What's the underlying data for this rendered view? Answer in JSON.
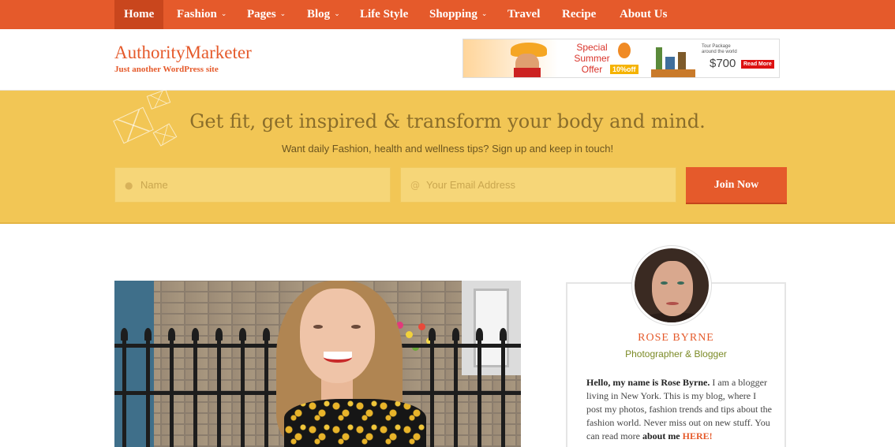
{
  "nav": {
    "items": [
      {
        "label": "Home",
        "active": true,
        "dropdown": false
      },
      {
        "label": "Fashion",
        "active": false,
        "dropdown": true
      },
      {
        "label": "Pages",
        "active": false,
        "dropdown": true
      },
      {
        "label": "Blog",
        "active": false,
        "dropdown": true
      },
      {
        "label": "Life Style",
        "active": false,
        "dropdown": false
      },
      {
        "label": "Shopping",
        "active": false,
        "dropdown": true
      },
      {
        "label": "Travel",
        "active": false,
        "dropdown": false
      },
      {
        "label": "Recipe",
        "active": false,
        "dropdown": false
      },
      {
        "label": "About Us",
        "active": false,
        "dropdown": false
      }
    ],
    "caret_glyph": "⌄"
  },
  "header": {
    "site_title": "AuthorityMarketer",
    "tagline": "Just another WordPress site",
    "ad": {
      "special_line1": "Special",
      "special_line2": "Summer",
      "special_line3": "Offer",
      "discount": "10%off",
      "tour_line1": "Tour Package",
      "tour_line2": "around the world",
      "price": "$700",
      "read_more": "Read More"
    }
  },
  "optin": {
    "heading": "Get fit, get inspired & transform your body and mind.",
    "subheading": "Want daily Fashion, health and wellness tips? Sign up and keep in touch!",
    "name_placeholder": "Name",
    "email_placeholder": "Your Email Address",
    "button_label": "Join Now"
  },
  "sidebar": {
    "author_name": "ROSE BYRNE",
    "author_role": "Photographer & Blogger",
    "bio_intro": "Hello, my name is Rose Byrne.",
    "bio_text": " I am a blogger living in New York. This is my blog, where I post my photos, fashion trends and tips about the fashion world. Never miss out on new stuff. You can read more ",
    "bio_about": "about me",
    "bio_here": "HERE!"
  },
  "colors": {
    "brand": "#e55a2b",
    "optin_bg": "#f2c655",
    "role_green": "#7b8a26"
  }
}
